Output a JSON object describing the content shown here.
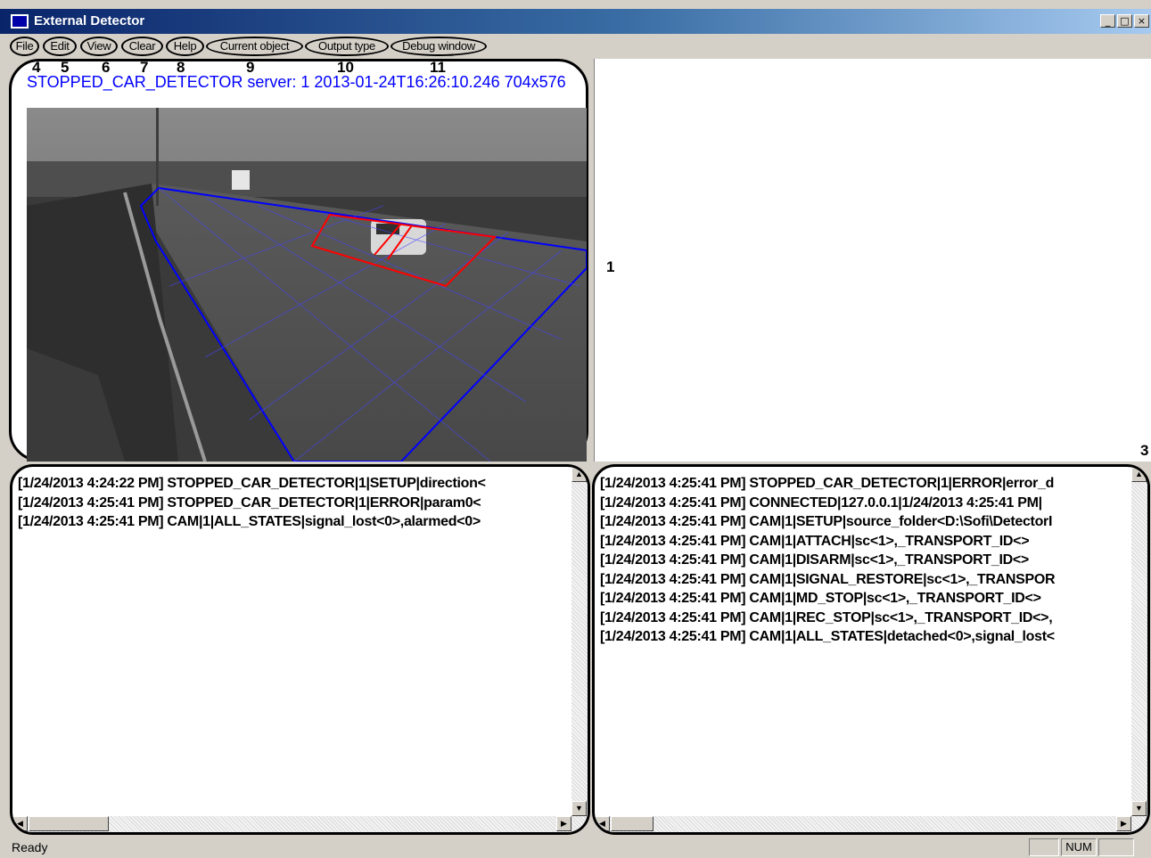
{
  "window": {
    "title": "External Detector",
    "controls": [
      "_",
      "□",
      "×"
    ]
  },
  "menu": {
    "items": [
      "File",
      "Edit",
      "View",
      "Clear",
      "Help",
      "Current object",
      "Output type",
      "Debug window"
    ]
  },
  "callouts": {
    "n1": "1",
    "n3": "3",
    "n4": "4",
    "n5": "5",
    "n6": "6",
    "n7": "7",
    "n8": "8",
    "n9": "9",
    "n10": "10",
    "n11": "11"
  },
  "video": {
    "header": "STOPPED_CAR_DETECTOR server: 1 2013-01-24T16:26:10.246 704x576",
    "overlay_color": "#0000ff",
    "alert_color": "#ff0000"
  },
  "log_left": {
    "lines": [
      "[1/24/2013 4:24:22 PM] STOPPED_CAR_DETECTOR|1|SETUP|direction<",
      "[1/24/2013 4:25:41 PM] STOPPED_CAR_DETECTOR|1|ERROR|param0<",
      "[1/24/2013 4:25:41 PM] CAM|1|ALL_STATES|signal_lost<0>,alarmed<0>"
    ]
  },
  "log_right": {
    "lines": [
      "[1/24/2013 4:25:41 PM] STOPPED_CAR_DETECTOR|1|ERROR|error_d",
      "[1/24/2013 4:25:41 PM] CONNECTED|127.0.0.1|1/24/2013 4:25:41 PM|",
      "[1/24/2013 4:25:41 PM] CAM|1|SETUP|source_folder<D:\\Sofi\\DetectorI",
      "[1/24/2013 4:25:41 PM] CAM|1|ATTACH|sc<1>,_TRANSPORT_ID<>",
      "[1/24/2013 4:25:41 PM] CAM|1|DISARM|sc<1>,_TRANSPORT_ID<>",
      "[1/24/2013 4:25:41 PM] CAM|1|SIGNAL_RESTORE|sc<1>,_TRANSPOR",
      "[1/24/2013 4:25:41 PM] CAM|1|MD_STOP|sc<1>,_TRANSPORT_ID<>",
      "[1/24/2013 4:25:41 PM] CAM|1|REC_STOP|sc<1>,_TRANSPORT_ID<>,",
      "[1/24/2013 4:25:41 PM] CAM|1|ALL_STATES|detached<0>,signal_lost<"
    ]
  },
  "status": {
    "text": "Ready",
    "num": "NUM"
  }
}
